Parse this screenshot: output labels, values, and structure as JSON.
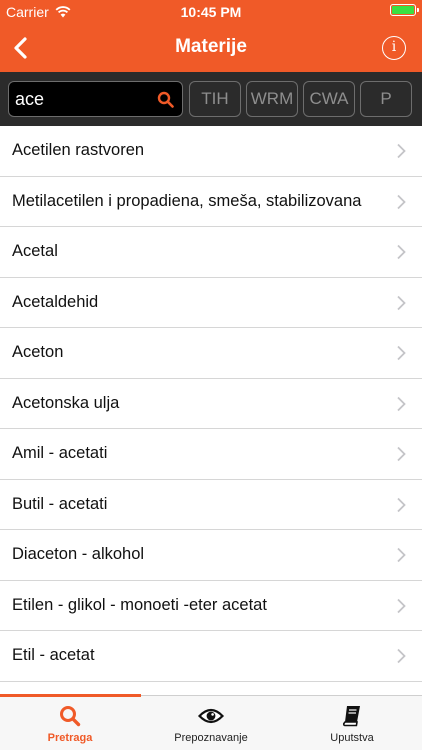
{
  "status": {
    "carrier": "Carrier",
    "time": "10:45 PM"
  },
  "header": {
    "title": "Materije",
    "back_icon": "chevron-left-icon",
    "info_icon": "info-icon"
  },
  "search": {
    "value": "ace",
    "placeholder": ""
  },
  "filters": [
    "TIH",
    "WRM",
    "CWA",
    "P"
  ],
  "items": [
    "Acetilen rastvoren",
    "Metilacetilen i propadiena, smeša, stabilizovana",
    "Acetal",
    "Acetaldehid",
    "Aceton",
    "Acetonska ulja",
    "Amil - acetati",
    "Butil - acetati",
    "Diaceton - alkohol",
    "Etilen - glikol - monoeti -eter acetat",
    "Etil - acetat"
  ],
  "tabs": [
    {
      "label": "Pretraga",
      "icon": "search-icon",
      "active": true
    },
    {
      "label": "Prepoznavanje",
      "icon": "eye-icon",
      "active": false
    },
    {
      "label": "Uputstva",
      "icon": "book-icon",
      "active": false
    }
  ],
  "colors": {
    "accent": "#f05a28",
    "battery": "#3adf42",
    "filterbar": "#2b2b2b"
  }
}
